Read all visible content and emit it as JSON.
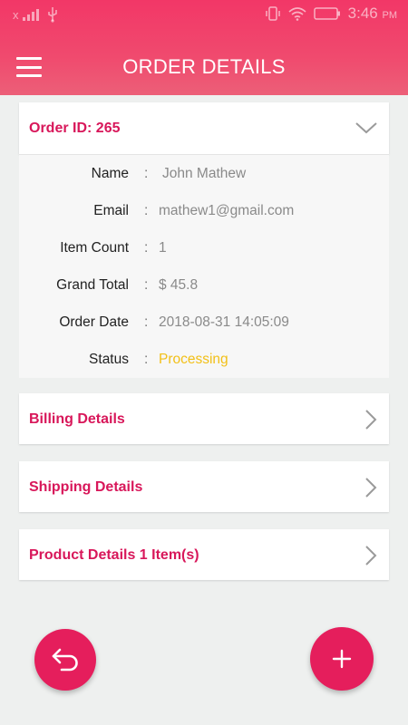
{
  "status_bar": {
    "carrier": "x",
    "time": "3:46",
    "ampm": "PM"
  },
  "header": {
    "title": "ORDER DETAILS",
    "menu_icon": "hamburger-menu-icon"
  },
  "order": {
    "id_label": "Order ID: 265",
    "fields": [
      {
        "label": "Name",
        "value": "John Mathew"
      },
      {
        "label": "Email",
        "value": "mathew1@gmail.com"
      },
      {
        "label": "Item Count",
        "value": "1"
      },
      {
        "label": "Grand Total",
        "value": "$ 45.8"
      },
      {
        "label": "Order Date",
        "value": "2018-08-31 14:05:09"
      },
      {
        "label": "Status",
        "value": "Processing"
      }
    ],
    "separator": ":"
  },
  "sections": [
    {
      "title": "Billing Details"
    },
    {
      "title": "Shipping Details"
    },
    {
      "title": "Product Details 1 Item(s)"
    }
  ],
  "colors": {
    "accent": "#e51e5c",
    "title_pink": "#d8175a",
    "status_processing": "#f2c018"
  },
  "fabs": {
    "left_icon": "undo-back-icon",
    "right_icon": "plus-icon"
  }
}
